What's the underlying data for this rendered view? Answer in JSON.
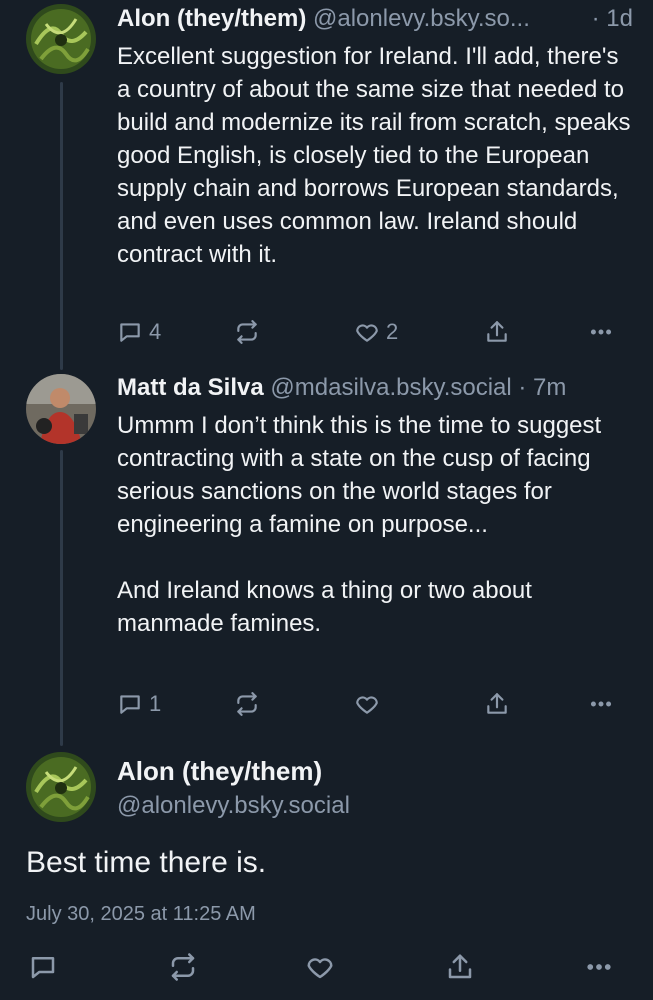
{
  "posts": [
    {
      "author_name": "Alon (they/them)",
      "handle": "@alonlevy.bsky.so...",
      "time": "· 1d",
      "text": "Excellent suggestion for Ireland. I'll add, there's a country of about the same size that needed to build and modernize its rail from scratch, speaks good English, is closely tied to the European supply chain and borrows European standards, and even uses common law. Ireland should contract with it.",
      "replies": "4",
      "reposts": "",
      "likes": "2"
    },
    {
      "author_name": "Matt da Silva",
      "handle": "@mdasilva.bsky.social",
      "time": "· 7m",
      "text": "Ummm I don’t think this is the time to suggest contracting with a state on the cusp of facing serious sanctions on the world stages for engineering a famine on purpose...\n\nAnd Ireland knows a thing or two about manmade famines.",
      "replies": "1",
      "reposts": "",
      "likes": ""
    }
  ],
  "main_post": {
    "author_name": "Alon (they/them)",
    "handle": "@alonlevy.bsky.social",
    "text": "Best time there is.",
    "date": "July 30, 2025 at 11:25 AM"
  },
  "icons": [
    "reply-icon",
    "repost-icon",
    "like-icon",
    "share-icon",
    "more-icon"
  ],
  "colors": {
    "background": "#161e27",
    "text": "#f1f3f5",
    "muted": "#8c99aa",
    "thread_line": "#2e3a48"
  }
}
